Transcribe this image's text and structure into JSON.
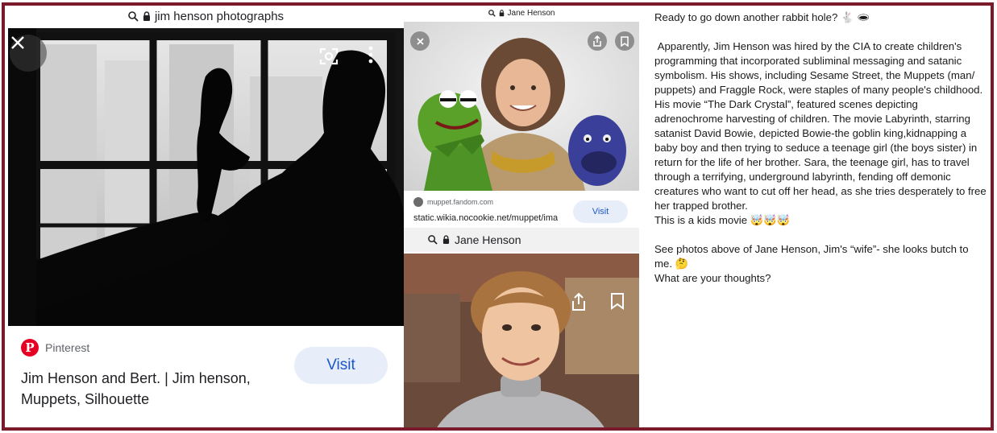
{
  "left_panel": {
    "url_text": "jim henson photographs",
    "source_name": "Pinterest",
    "visit_label": "Visit",
    "result_title": "Jim Henson and Bert. | Jim henson, Muppets, Silhouette",
    "icons": [
      "search-icon",
      "lock-icon",
      "close-icon",
      "lens-icon",
      "more-vert-icon",
      "pinterest-logo-icon"
    ]
  },
  "middle_top": {
    "url_text": "Jane Henson",
    "site_name": "muppet.fandom.com",
    "full_url": "static.wikia.nocookie.net/muppet/ima",
    "visit_label": "Visit",
    "icons": [
      "close-icon",
      "share-icon",
      "bookmark-icon"
    ]
  },
  "middle_bottom": {
    "url_text": "Jane Henson",
    "icons": [
      "search-icon",
      "lock-icon",
      "share-icon",
      "bookmark-icon"
    ]
  },
  "post": {
    "line1": "Ready to go down another rabbit hole? 🐇 🕳",
    "para1": " Apparently, Jim Henson was hired by the CIA to create children's programming that incorporated subliminal messaging and satanic symbolism. His shows, including Sesame Street, the Muppets (man/ puppets) and Fraggle Rock, were staples of many people's childhood. His movie “The Dark Crystal”, featured scenes depicting adrenochrome harvesting of children. The movie Labyrinth, starring satanist David Bowie, depicted Bowie-the goblin king,kidnapping a baby boy and then trying to seduce a teenage girl (the boys sister) in return for the life of her brother. Sara, the teenage girl, has to travel through a terrifying, underground labyrinth, fending off demonic creatures who want to cut off her head, as she tries desperately to free her trapped brother.",
    "kids_line": "This is a kids movie 🤯🤯🤯",
    "para2": "See photos above of Jane Henson, Jim's “wife”- she looks butch to me. 🤔",
    "question": "What are your thoughts?"
  },
  "colors": {
    "frame_border": "#7a1a2a",
    "visit_bg": "#e8eef9",
    "visit_text": "#1a57c9",
    "pinterest_red": "#e60023"
  }
}
